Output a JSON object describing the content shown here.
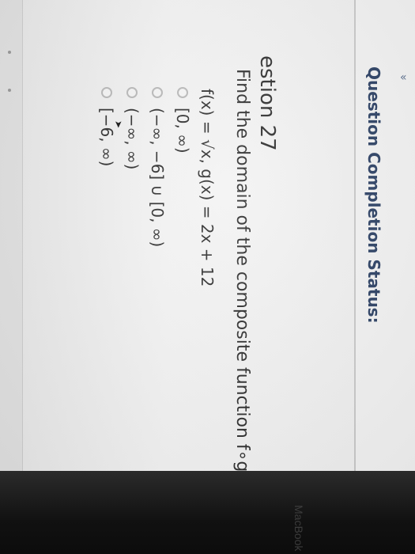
{
  "status": {
    "chevron": "«",
    "label": "Question Completion Status:"
  },
  "question": {
    "title": "estion 27",
    "prompt": "Find the domain of the composite function f∘g.",
    "functions": "f(x) = √x, g(x) = 2x + 12",
    "options": [
      {
        "label": "[0, ∞)"
      },
      {
        "label": "(−∞, −6] ∪ [0, ∞)"
      },
      {
        "label": "(−∞, ∞)"
      },
      {
        "label": "[−6, ∞)"
      }
    ]
  },
  "device": {
    "brand": "MacBook Pro"
  }
}
